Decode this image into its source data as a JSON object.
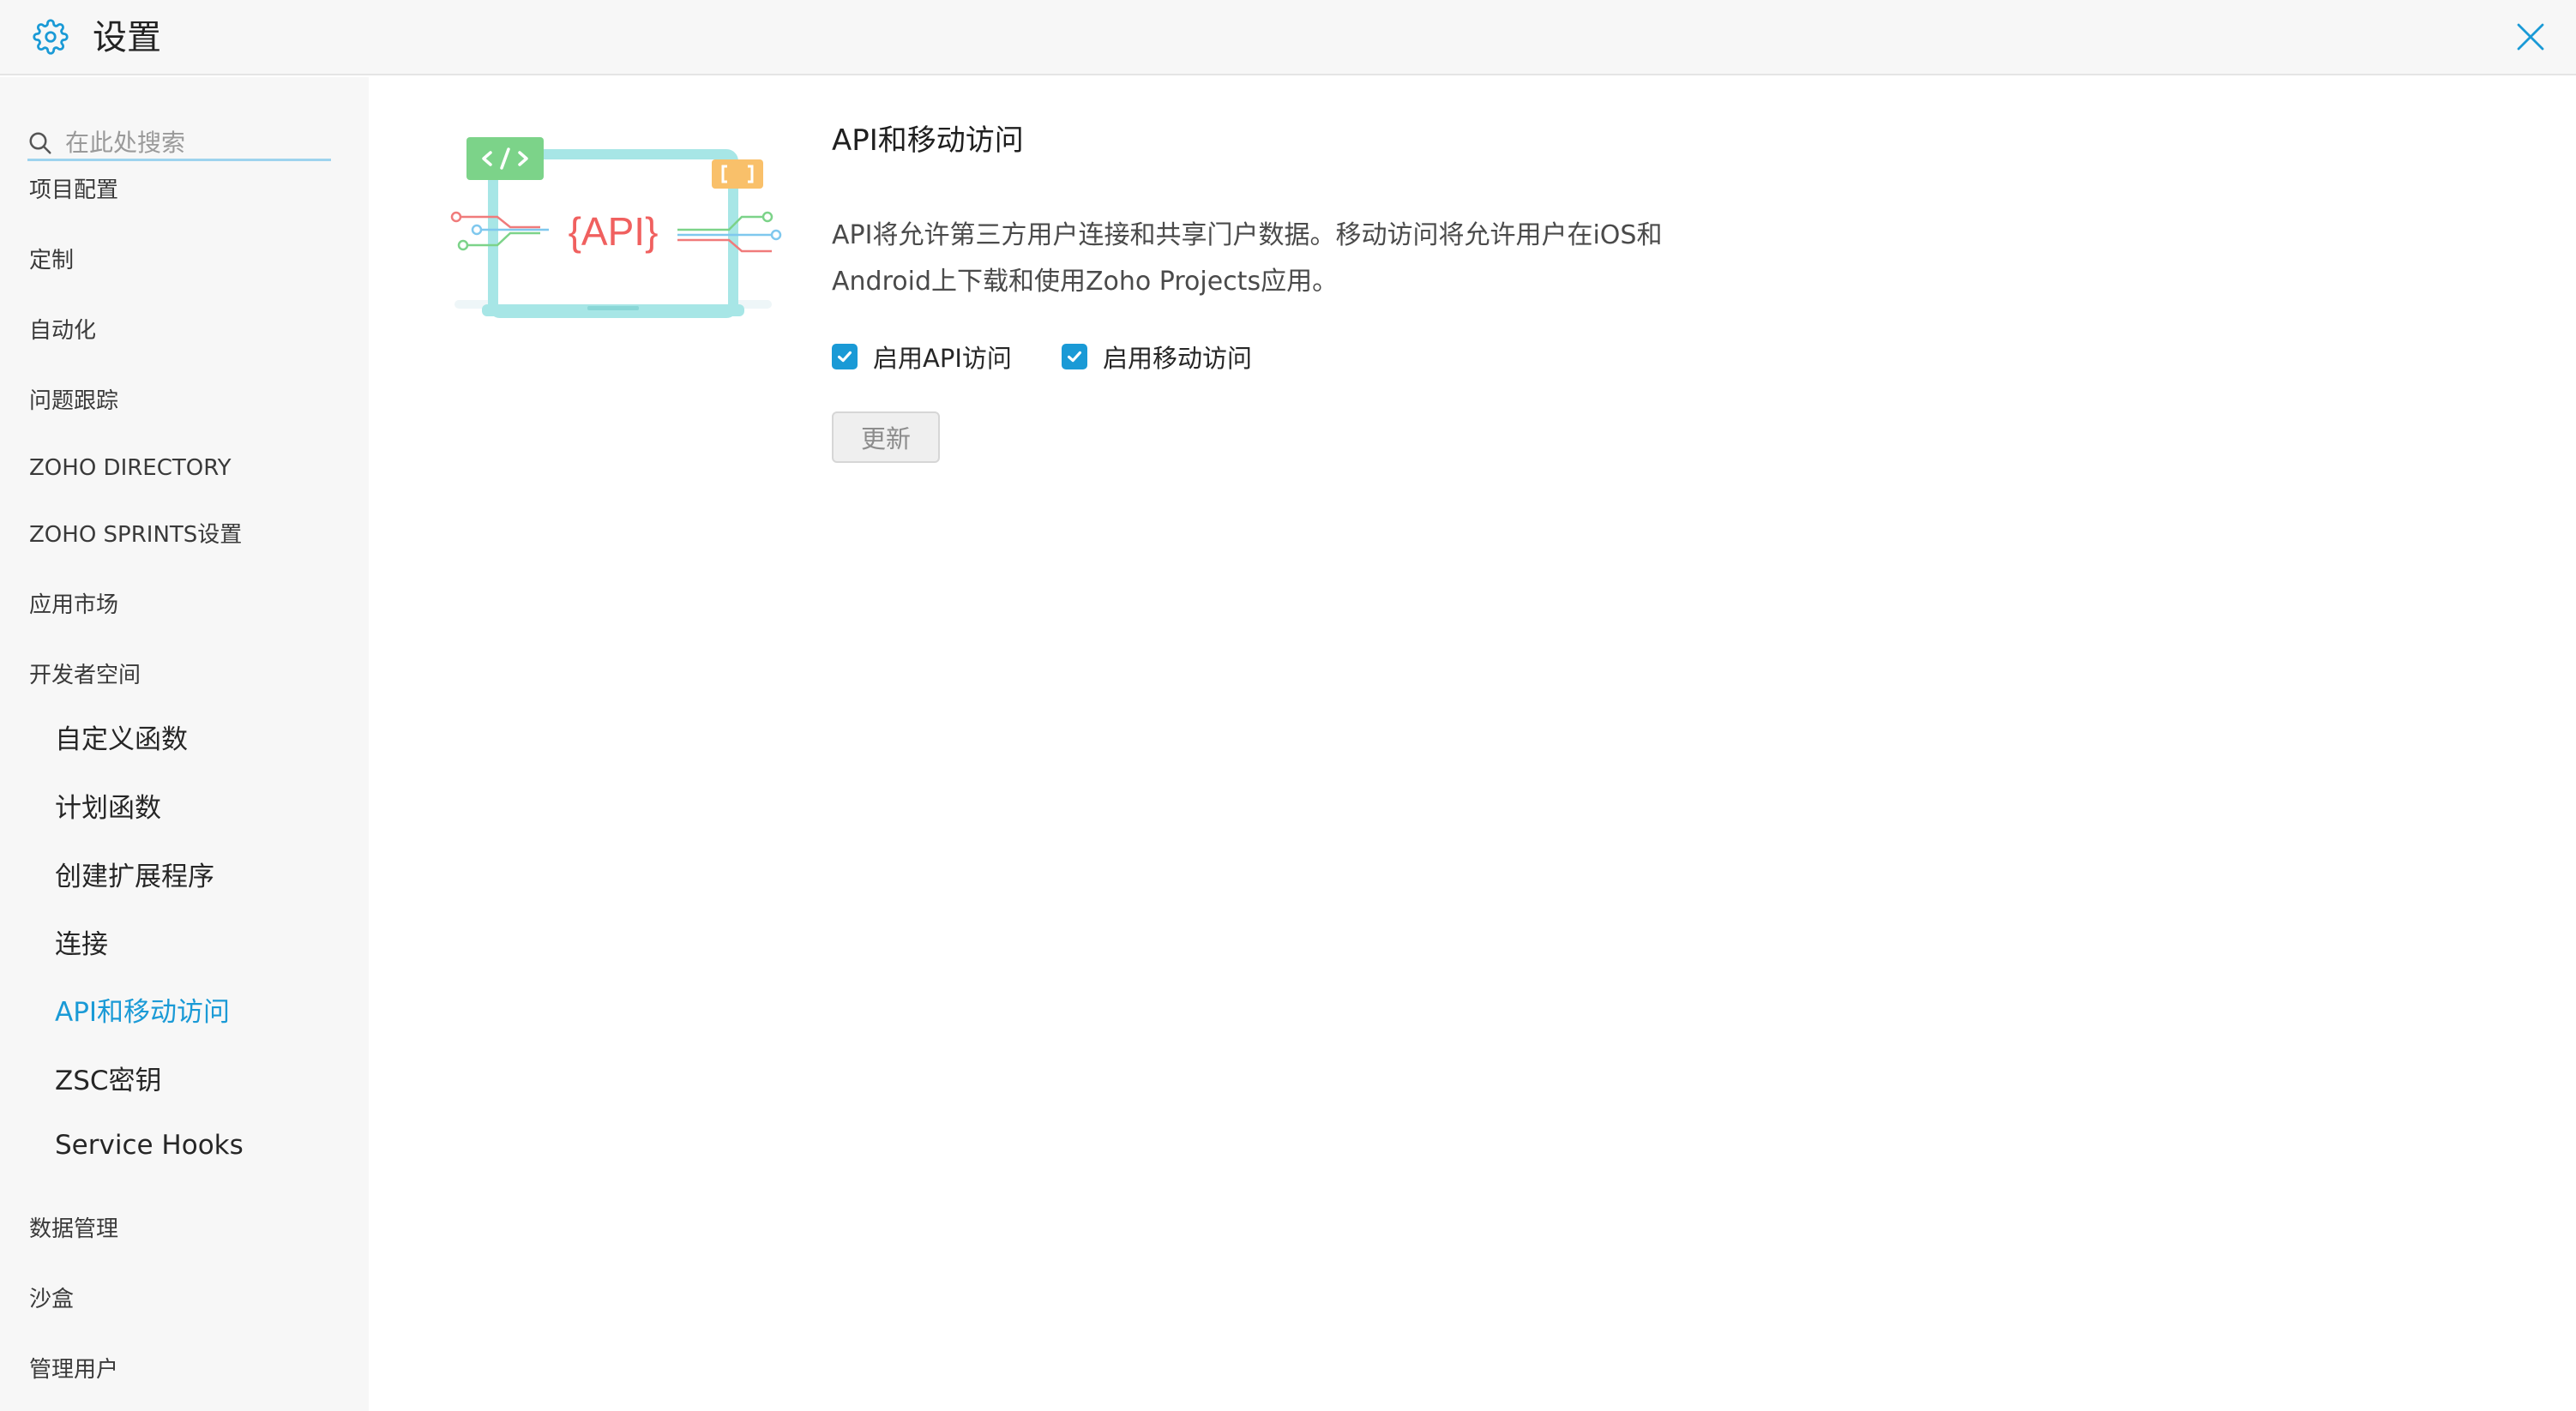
{
  "header": {
    "title": "设置",
    "settings_icon": "gear-icon",
    "close_icon": "close-icon",
    "accent_color": "#1a9ad6"
  },
  "sidebar": {
    "search": {
      "placeholder": "在此处搜索",
      "value": ""
    },
    "items": [
      {
        "label": "项目配置"
      },
      {
        "label": "定制"
      },
      {
        "label": "自动化"
      },
      {
        "label": "问题跟踪"
      },
      {
        "label": "ZOHO DIRECTORY"
      },
      {
        "label": "ZOHO SPRINTS设置"
      },
      {
        "label": "应用市场"
      },
      {
        "label": "开发者空间"
      }
    ],
    "sub_items": [
      {
        "label": "自定义函数"
      },
      {
        "label": "计划函数"
      },
      {
        "label": "创建扩展程序"
      },
      {
        "label": "连接"
      },
      {
        "label": "API和移动访问",
        "active": true
      },
      {
        "label": "ZSC密钥"
      },
      {
        "label": "Service Hooks"
      }
    ],
    "bottom_items": [
      {
        "label": "数据管理"
      },
      {
        "label": "沙盒"
      },
      {
        "label": "管理用户"
      }
    ]
  },
  "main": {
    "illustration_text": "{API}",
    "title": "API和移动访问",
    "description_lines": [
      "API将允许第三方用户连接和共享门户数据。移动访问将允许用户在iOS和",
      "Android上下载和使用Zoho Projects应用。"
    ],
    "checkboxes": [
      {
        "label": "启用API访问",
        "checked": true
      },
      {
        "label": "启用移动访问",
        "checked": true
      }
    ],
    "update_button": "更新"
  }
}
